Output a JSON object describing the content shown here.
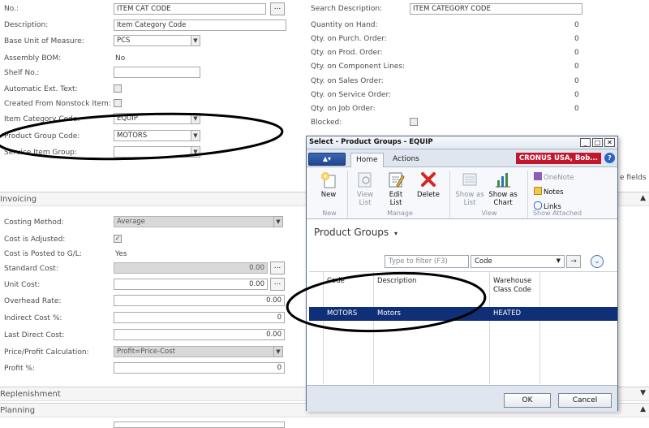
{
  "general": {
    "no_label": "No.:",
    "no_value": "ITEM CAT CODE",
    "description_label": "Description:",
    "description_value": "Item Category Code",
    "base_unit_label": "Base Unit of Measure:",
    "base_unit_value": "PCS",
    "assembly_bom_label": "Assembly BOM:",
    "assembly_bom_value": "No",
    "shelf_no_label": "Shelf No.:",
    "auto_ext_text_label": "Automatic Ext. Text:",
    "nonstock_label": "Created From Nonstock Item:",
    "item_category_label": "Item Category Code:",
    "item_category_value": "EQUIP",
    "product_group_label": "Product Group Code:",
    "product_group_value": "MOTORS",
    "service_item_group_label": "Service Item Group:"
  },
  "right_panel": {
    "search_desc_label": "Search Description:",
    "search_desc_value": "ITEM CATEGORY CODE",
    "qty_on_hand_label": "Quantity on Hand:",
    "qty_on_hand_value": "0",
    "qty_purch_label": "Qty. on Purch. Order:",
    "qty_purch_value": "0",
    "qty_prod_label": "Qty. on Prod. Order:",
    "qty_prod_value": "0",
    "qty_component_label": "Qty. on Component Lines:",
    "qty_component_value": "0",
    "qty_sales_label": "Qty. on Sales Order:",
    "qty_sales_value": "0",
    "qty_service_label": "Qty. on Service Order:",
    "qty_service_value": "0",
    "qty_job_label": "Qty. on Job Order:",
    "qty_job_value": "0",
    "blocked_label": "Blocked:",
    "fields_tail": "e fields"
  },
  "invoicing": {
    "section_title": "Invoicing",
    "costing_method_label": "Costing Method:",
    "costing_method_value": "Average",
    "cost_adjusted_label": "Cost is Adjusted:",
    "cost_posted_label": "Cost is Posted to G/L:",
    "cost_posted_value": "Yes",
    "standard_cost_label": "Standard Cost:",
    "standard_cost_value": "0.00",
    "unit_cost_label": "Unit Cost:",
    "unit_cost_value": "0.00",
    "overhead_rate_label": "Overhead Rate:",
    "overhead_rate_value": "0.00",
    "indirect_cost_label": "Indirect Cost %:",
    "indirect_cost_value": "0",
    "last_direct_cost_label": "Last Direct Cost:",
    "last_direct_cost_value": "0.00",
    "price_profit_label": "Price/Profit Calculation:",
    "price_profit_value": "Profit=Price-Cost",
    "profit_pct_label": "Profit %:",
    "profit_pct_value": "0"
  },
  "sections": {
    "replenishment": "Replenishment",
    "planning": "Planning"
  },
  "dialog": {
    "title": "Select - Product Groups - EQUIP",
    "app_menu": "▲▾",
    "tab_home": "Home",
    "tab_actions": "Actions",
    "company": "CRONUS USA, Bob...",
    "help": "?",
    "btn_new": "New",
    "btn_view_list": "View List",
    "btn_edit_list": "Edit List",
    "btn_delete": "Delete",
    "btn_show_as_list": "Show as List",
    "btn_show_as_chart": "Show as Chart",
    "btn_onenote": "OneNote",
    "btn_notes": "Notes",
    "btn_links": "Links",
    "group_new": "New",
    "group_manage": "Manage",
    "group_view": "View",
    "group_show_attached": "Show Attached",
    "page_title": "Product Groups",
    "filter_placeholder": "Type to filter (F3)",
    "filter_field": "Code",
    "col_code": "Code",
    "col_description": "Description",
    "col_warehouse": "Warehouse Class Code",
    "row_code": "MOTORS",
    "row_description": "Motors",
    "row_warehouse": "HEATED",
    "ok": "OK",
    "cancel": "Cancel"
  }
}
